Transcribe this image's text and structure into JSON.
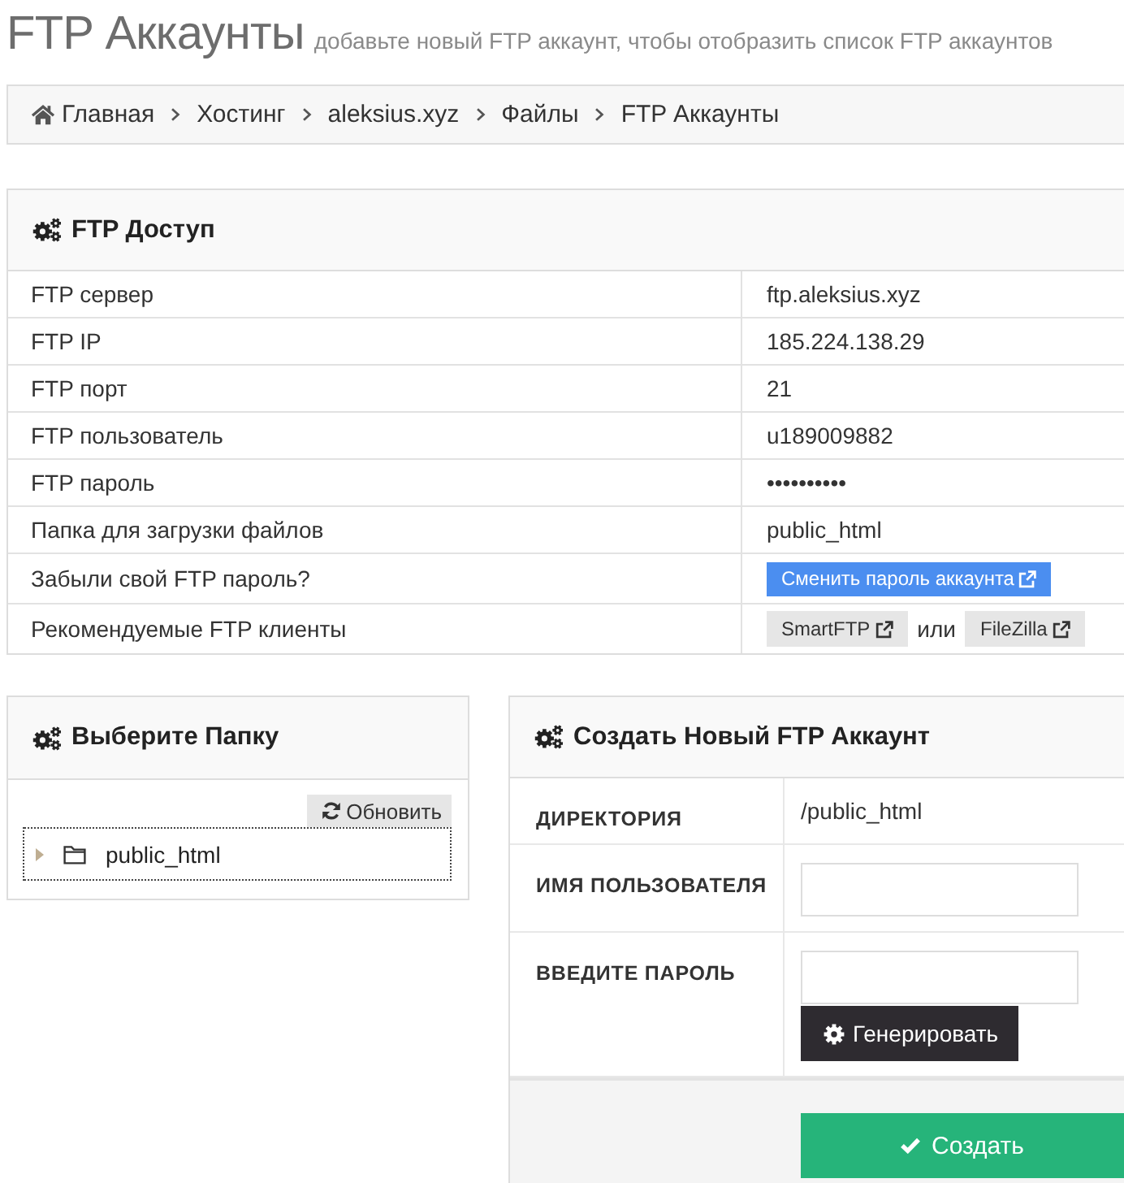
{
  "page_header": {
    "title": "FTP Аккаунты",
    "subtitle": "добавьте новый FTP аккаунт, чтобы отобразить список FTP аккаунтов"
  },
  "breadcrumb": [
    {
      "label": "Главная",
      "kind": "home"
    },
    {
      "label": "Хостинг",
      "kind": "link"
    },
    {
      "label": "aleksius.xyz",
      "kind": "link"
    },
    {
      "label": "Файлы",
      "kind": "link"
    },
    {
      "label": "FTP Аккаунты",
      "kind": "link"
    }
  ],
  "ftp_access": {
    "title": "FTP Доступ",
    "rows": [
      {
        "label": "FTP сервер",
        "kind": "text",
        "value": "ftp.aleksius.xyz"
      },
      {
        "label": "FTP IP",
        "kind": "text",
        "value": "185.224.138.29"
      },
      {
        "label": "FTP порт",
        "kind": "text",
        "value": "21"
      },
      {
        "label": "FTP пользователь",
        "kind": "text",
        "value": "u189009882"
      },
      {
        "label": "FTP пароль",
        "kind": "text",
        "value": "••••••••••"
      },
      {
        "label": "Папка для загрузки файлов",
        "kind": "text",
        "value": "public_html"
      },
      {
        "label": "Забыли свой FTP пароль?",
        "kind": "button",
        "button": "Сменить пароль аккаунта"
      },
      {
        "label": "Рекомендуемые FTP клиенты",
        "kind": "clients",
        "clients": [
          "SmartFTP",
          "FileZilla"
        ],
        "separator": "или"
      }
    ]
  },
  "folder_panel": {
    "title": "Выберите Папку",
    "refresh_button": "Обновить",
    "tree": [
      {
        "label": "public_html",
        "expanded": false
      }
    ]
  },
  "create_panel": {
    "title": "Создать Новый FTP Аккаунт",
    "fields": [
      {
        "label": "ДИРЕКТОРИЯ",
        "kind": "text",
        "value": "/public_html"
      },
      {
        "label": "ИМЯ ПОЛЬЗОВАТЕЛЯ",
        "kind": "input"
      },
      {
        "label": "ВВЕДИТЕ ПАРОЛЬ",
        "kind": "password",
        "button": "Генерировать"
      }
    ],
    "submit_button": "Создать"
  }
}
